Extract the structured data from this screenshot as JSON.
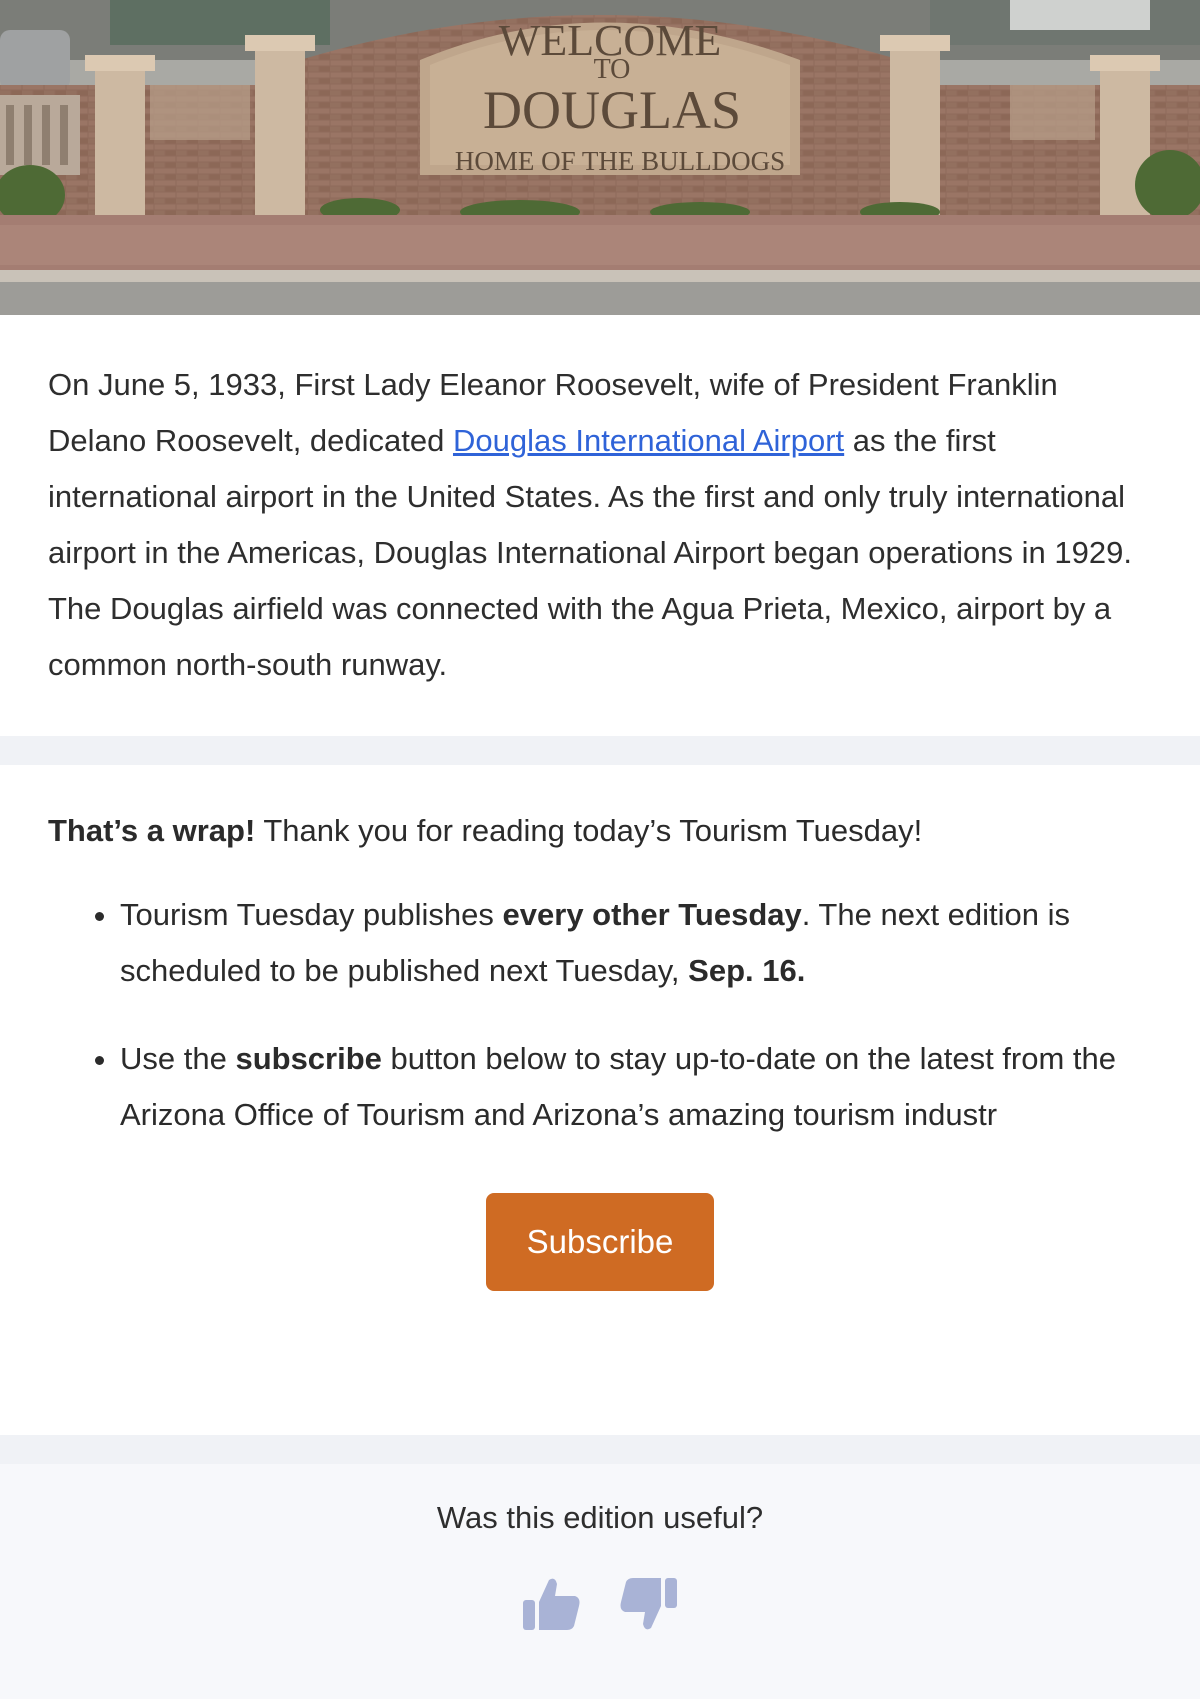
{
  "hero": {
    "sign_line1": "WELCOME",
    "sign_line2": "TO",
    "sign_line3": "DOUGLAS",
    "sign_line4": "HOME OF THE BULLDOGS"
  },
  "article": {
    "text_before": "On June 5, 1933, First Lady Eleanor Roosevelt, wife of President Franklin Delano Roosevelt, dedicated ",
    "link_text": "Douglas International Airport",
    "text_after": " as the first international airport in the United States. As the first and only truly international airport in the Americas, Douglas International Airport began operations in 1929. The Douglas airfield was connected with the Agua Prieta, Mexico, airport by a common north-south runway."
  },
  "wrap": {
    "lead_bold": "That’s a wrap!",
    "lead_rest": " Thank you for reading today’s Tourism Tuesday!",
    "bullet1_a": "Tourism Tuesday publishes ",
    "bullet1_bold": "every other Tuesday",
    "bullet1_b": ". The next edition is scheduled to be published next Tuesday, ",
    "bullet1_date": "Sep. 16.",
    "bullet2_a": "Use the ",
    "bullet2_bold": "subscribe",
    "bullet2_b": " button below to stay up-to-date on the latest from the Arizona Office of Tourism and Arizona’s amazing tourism industr"
  },
  "subscribe_label": "Subscribe",
  "feedback": {
    "question": "Was this edition useful?"
  },
  "colors": {
    "link": "#2f63d8",
    "button": "#cf6b23",
    "thumb": "#a9b3d6",
    "divider": "#f0f2f6"
  },
  "icons": [
    "thumbs-up-icon",
    "thumbs-down-icon"
  ]
}
